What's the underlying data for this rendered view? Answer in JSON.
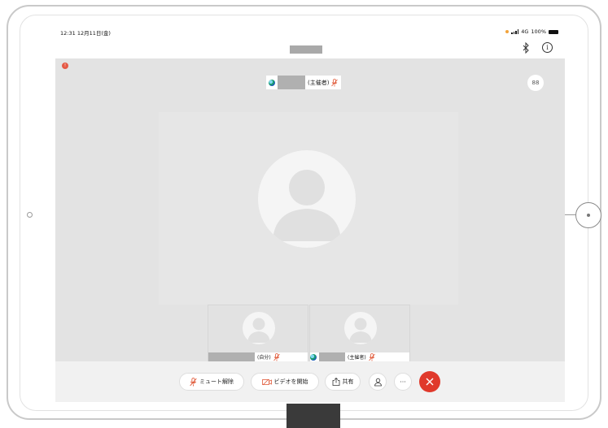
{
  "status_bar": {
    "time": "12:31",
    "date": "12月11日(金)",
    "network": "4G",
    "battery": "100%"
  },
  "header": {
    "bluetooth_icon": "bluetooth-icon",
    "info_icon": "info-icon",
    "info_glyph": "i"
  },
  "main_video": {
    "speaker_suffix": "(主催者)",
    "layout_glyph": "88"
  },
  "thumbnails": [
    {
      "label": "(自分)"
    },
    {
      "label": "(主催者)"
    }
  ],
  "controls": {
    "unmute_label": "ミュート解除",
    "start_video_label": "ビデオを開始",
    "share_label": "共有",
    "more_glyph": "···"
  },
  "colors": {
    "end_call": "#e0392b",
    "muted_mic": "#e05a3a",
    "notification": "#e55a46"
  }
}
